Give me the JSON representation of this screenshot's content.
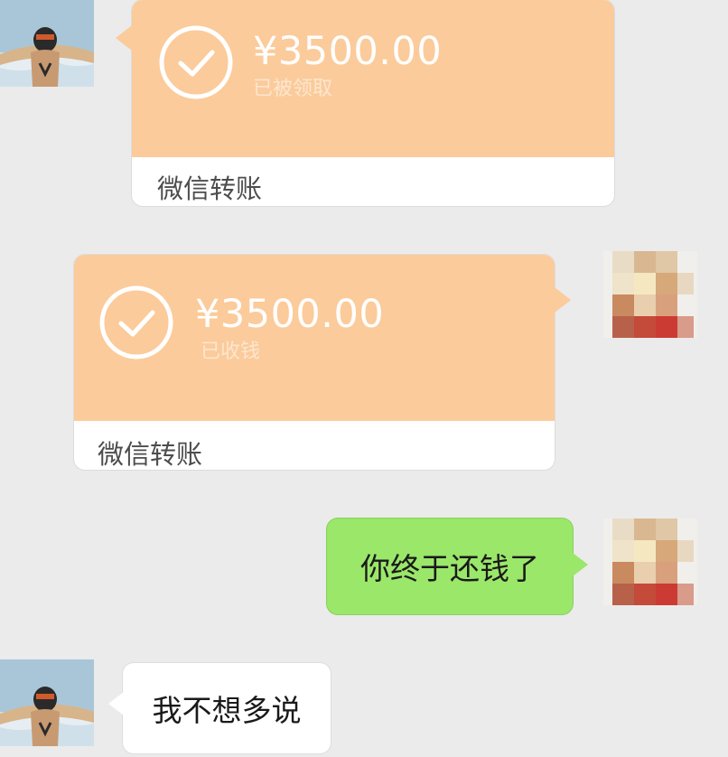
{
  "messages": [
    {
      "type": "transfer",
      "side": "left",
      "amount": "¥3500.00",
      "status": "已被领取",
      "footer": "微信转账"
    },
    {
      "type": "transfer",
      "side": "right",
      "amount": "¥3500.00",
      "status": "已收钱",
      "footer": "微信转账"
    },
    {
      "type": "text",
      "side": "right",
      "text": "你终于还钱了"
    },
    {
      "type": "text",
      "side": "left",
      "text": "我不想多说"
    }
  ],
  "colors": {
    "background": "#ebebeb",
    "transfer_top": "#fbcb9b",
    "sent_bubble": "#9ae76a",
    "received_bubble": "#ffffff"
  },
  "icons": {
    "left_avatar": "anime-character-avatar",
    "right_avatar": "pixelated-avatar",
    "transfer_check": "check-circle-icon"
  }
}
